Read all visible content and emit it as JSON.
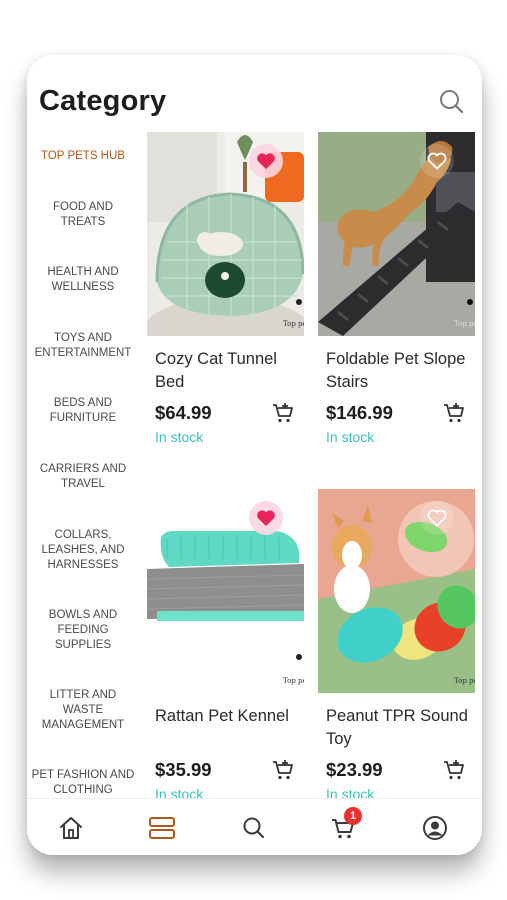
{
  "header": {
    "title": "Category"
  },
  "sidebar": {
    "items": [
      {
        "label": "TOP PETS HUB"
      },
      {
        "label": "FOOD AND TREATS"
      },
      {
        "label": "HEALTH AND WELLNESS"
      },
      {
        "label": "TOYS AND ENTERTAINMENT"
      },
      {
        "label": "BEDS AND FURNITURE"
      },
      {
        "label": "CARRIERS AND TRAVEL"
      },
      {
        "label": "COLLARS, LEASHES, AND HARNESSES"
      },
      {
        "label": "BOWLS AND FEEDING SUPPLIES"
      },
      {
        "label": "LITTER AND WASTE MANAGEMENT"
      },
      {
        "label": "PET FASHION AND CLOTHING"
      }
    ]
  },
  "products": [
    {
      "name": "Cozy Cat Tunnel Bed",
      "price": "$64.99",
      "stock": "In stock",
      "favorite": true,
      "watermark": "Top pets"
    },
    {
      "name": "Foldable Pet Slope Stairs",
      "price": "$146.99",
      "stock": "In stock",
      "favorite": false,
      "watermark": "Top pets"
    },
    {
      "name": "Rattan Pet Kennel",
      "price": "$35.99",
      "stock": "In stock",
      "favorite": true,
      "watermark": "Top pets"
    },
    {
      "name": "Peanut TPR Sound Toy",
      "price": "$23.99",
      "stock": "In stock",
      "favorite": false,
      "watermark": "Top pets"
    }
  ],
  "bottom_nav": {
    "items": [
      "home-icon",
      "category-icon",
      "search-icon",
      "cart-icon",
      "profile-icon"
    ],
    "cart_badge": "1",
    "active": "category-icon"
  },
  "colors": {
    "accent": "#b2551e",
    "stock": "#3cc0b8",
    "favorite": "#e8245a",
    "badge": "#e8312c"
  }
}
